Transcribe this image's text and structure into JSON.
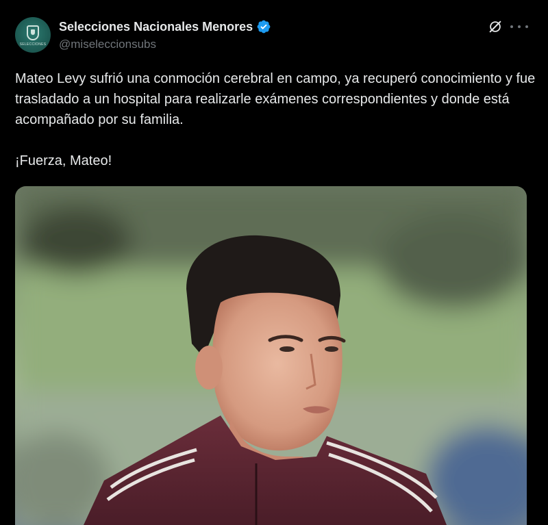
{
  "account": {
    "display_name": "Selecciones Nacionales Menores",
    "handle": "@miseleccionsubs",
    "avatar_caption": "SELECCIONES",
    "verified_icon": "verified-badge-icon",
    "verified_color": "#1d9bf0"
  },
  "header_actions": {
    "grok_icon": "grok-icon",
    "more_icon": "more-options-icon"
  },
  "tweet": {
    "paragraph_1": "Mateo Levy sufrió una conmoción cerebral en campo, ya recuperó conocimiento y fue trasladado a un hospital para realizarle exámenes correspondientes y donde está acompañado por su familia.",
    "paragraph_2": "¡Fuerza, Mateo!"
  },
  "media": {
    "type": "photo",
    "subject": "player-portrait-photo"
  },
  "colors": {
    "background": "#000000",
    "text_primary": "#e7e9ea",
    "text_secondary": "#71767b",
    "jacket": "#5a2632"
  }
}
